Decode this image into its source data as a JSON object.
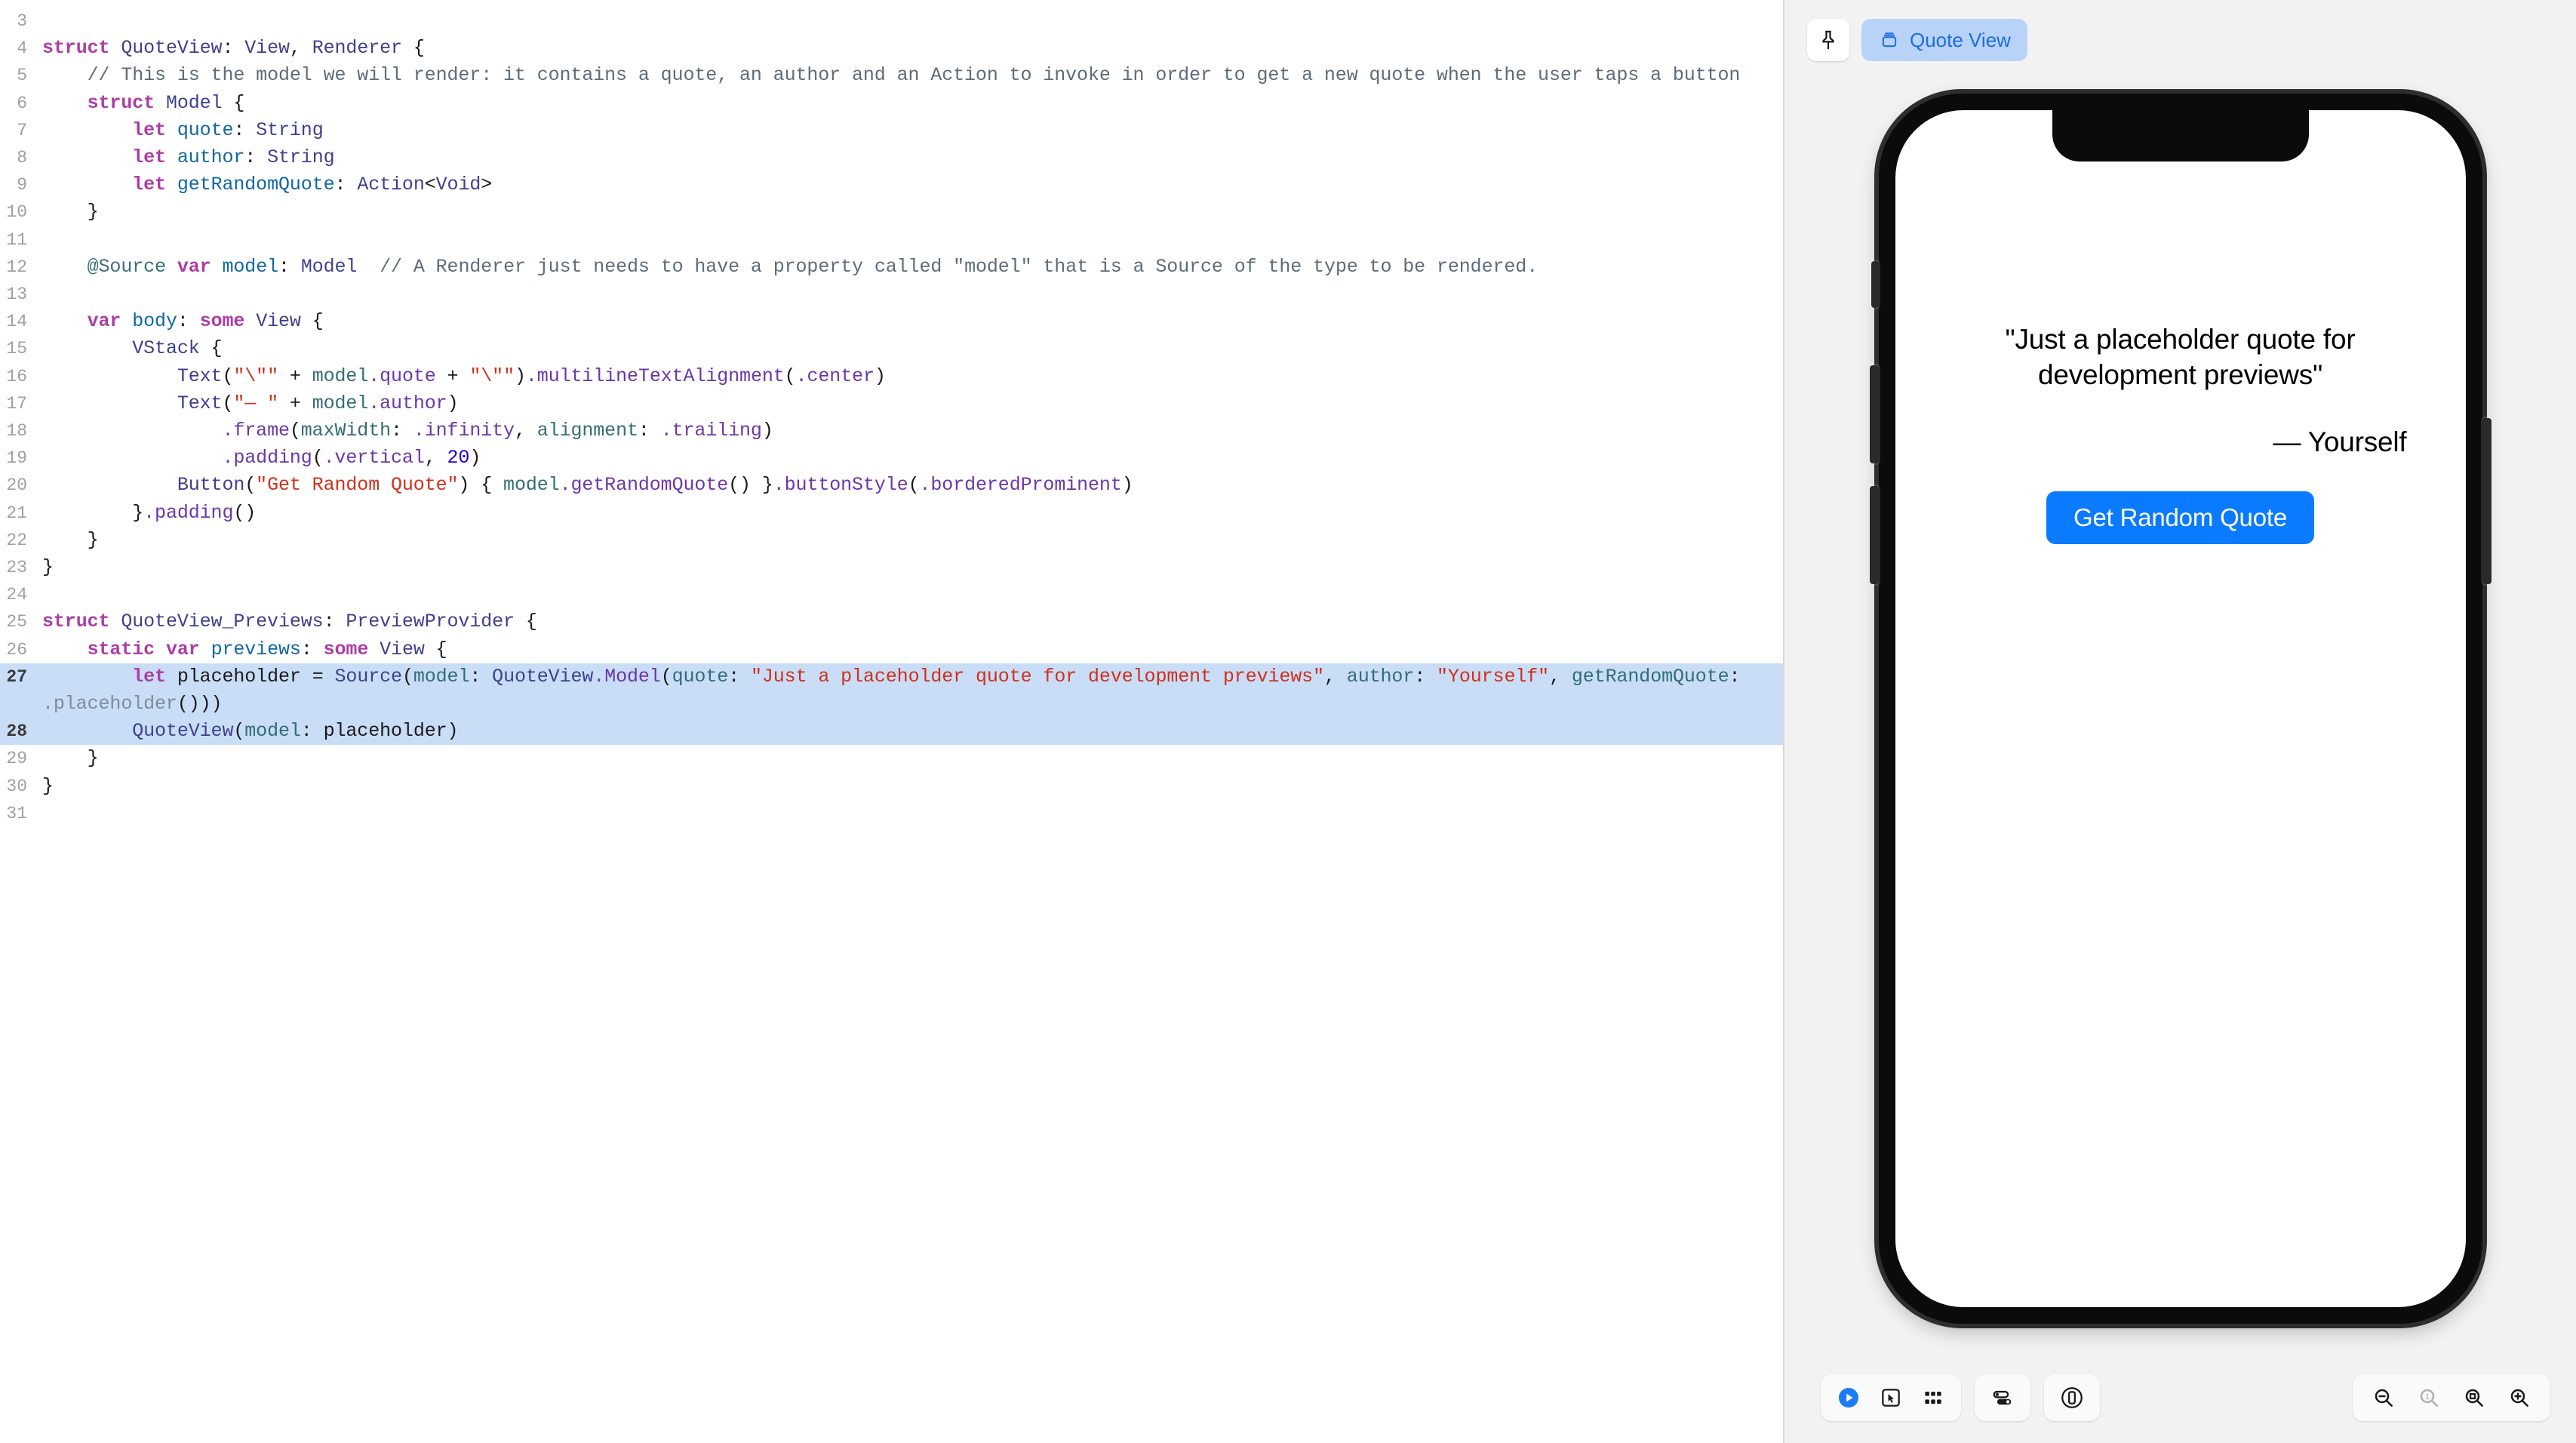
{
  "editor": {
    "language": "swift",
    "first_visible_line": 3,
    "highlighted_lines": [
      27,
      28
    ],
    "lines": [
      {
        "num": "3",
        "text": ""
      },
      {
        "num": "4",
        "text": "struct QuoteView: View, Renderer {"
      },
      {
        "num": "5",
        "text": "    // This is the model we will render: it contains a quote, an author and an Action to invoke in order to get a new quote when the user taps a button"
      },
      {
        "num": "6",
        "text": "    struct Model {"
      },
      {
        "num": "7",
        "text": "        let quote: String"
      },
      {
        "num": "8",
        "text": "        let author: String"
      },
      {
        "num": "9",
        "text": "        let getRandomQuote: Action<Void>"
      },
      {
        "num": "10",
        "text": "    }"
      },
      {
        "num": "11",
        "text": ""
      },
      {
        "num": "12",
        "text": "    @Source var model: Model  // A Renderer just needs to have a property called \"model\" that is a Source of the type to be rendered."
      },
      {
        "num": "13",
        "text": ""
      },
      {
        "num": "14",
        "text": "    var body: some View {"
      },
      {
        "num": "15",
        "text": "        VStack {"
      },
      {
        "num": "16",
        "text": "            Text(\"\\\"\" + model.quote + \"\\\"\").multilineTextAlignment(.center)"
      },
      {
        "num": "17",
        "text": "            Text(\"— \" + model.author)"
      },
      {
        "num": "18",
        "text": "                .frame(maxWidth: .infinity, alignment: .trailing)"
      },
      {
        "num": "19",
        "text": "                .padding(.vertical, 20)"
      },
      {
        "num": "20",
        "text": "            Button(\"Get Random Quote\") { model.getRandomQuote() }.buttonStyle(.borderedProminent)"
      },
      {
        "num": "21",
        "text": "        }.padding()"
      },
      {
        "num": "22",
        "text": "    }"
      },
      {
        "num": "23",
        "text": "}"
      },
      {
        "num": "24",
        "text": ""
      },
      {
        "num": "25",
        "text": "struct QuoteView_Previews: PreviewProvider {"
      },
      {
        "num": "26",
        "text": "    static var previews: some View {"
      },
      {
        "num": "27",
        "text": "        let placeholder = Source(model: QuoteView.Model(quote: \"Just a placeholder quote for development previews\", author: \"Yourself\", getRandomQuote: .placeholder()))"
      },
      {
        "num": "28",
        "text": "        QuoteView(model: placeholder)"
      },
      {
        "num": "29",
        "text": "    }"
      },
      {
        "num": "30",
        "text": "}"
      },
      {
        "num": "31",
        "text": ""
      }
    ]
  },
  "preview": {
    "top_bar": {
      "pin_icon": "pin-icon",
      "chip_icon": "preview-layers-icon",
      "chip_label": "Quote View"
    },
    "device": {
      "model": "iPhone",
      "has_notch": true
    },
    "app": {
      "quote": "\"Just a placeholder quote for development previews\"",
      "author": "— Yourself",
      "button_label": "Get Random Quote",
      "button_color": "#0a7aff"
    },
    "bottom_bar": {
      "play_label": "play-icon",
      "inspect_label": "selectable-icon",
      "variants_label": "variants-grid-icon",
      "device_settings_label": "device-settings-icon",
      "orientation_label": "device-orientation-icon",
      "zoom_out_label": "zoom-out-icon",
      "zoom_actual_label": "zoom-actual-size-icon",
      "zoom_fit_label": "zoom-fit-icon",
      "zoom_in_label": "zoom-in-icon",
      "zoom_actual_value": "1"
    }
  }
}
